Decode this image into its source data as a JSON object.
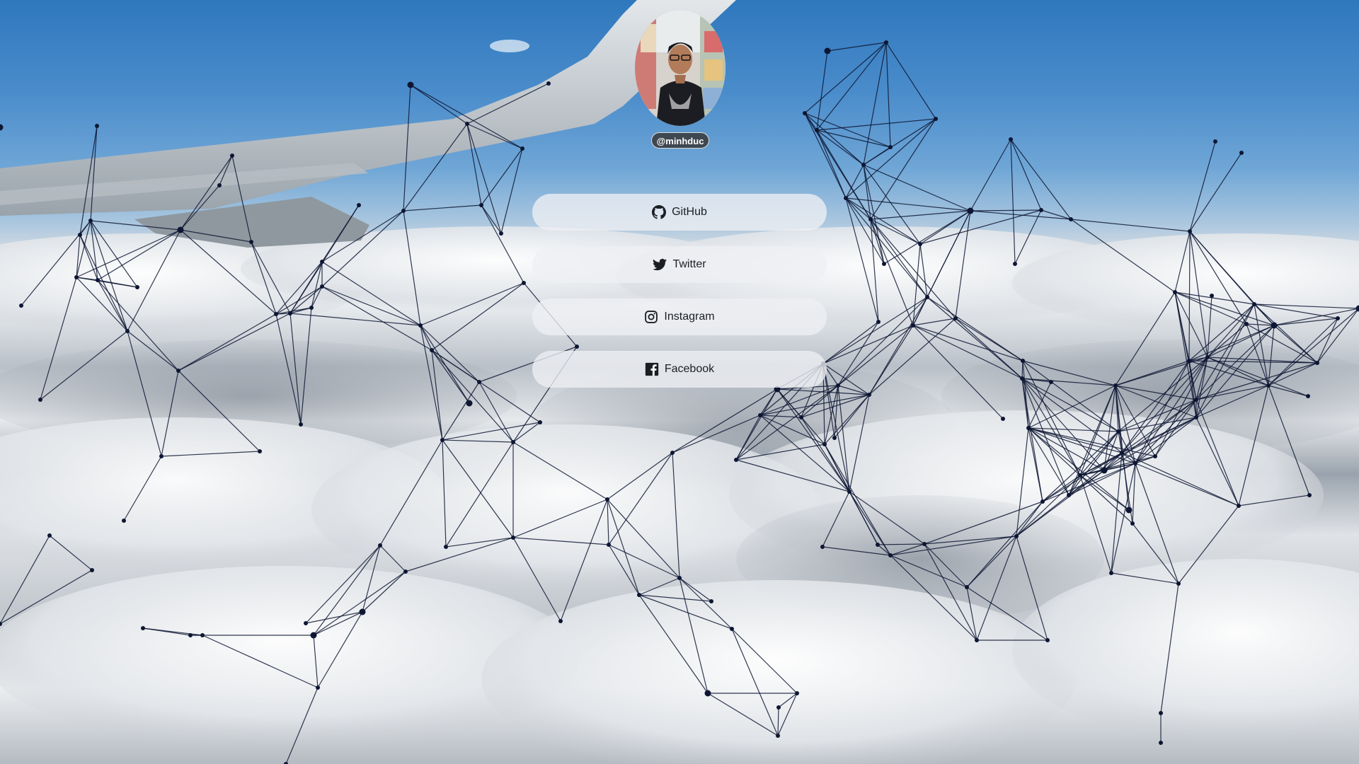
{
  "profile": {
    "handle": "@minhduc"
  },
  "links": [
    {
      "label": "GitHub",
      "icon": "github-icon"
    },
    {
      "label": "Twitter",
      "icon": "twitter-icon"
    },
    {
      "label": "Instagram",
      "icon": "instagram-icon"
    },
    {
      "label": "Facebook",
      "icon": "facebook-icon"
    }
  ],
  "theme": {
    "sky": "#2f78bd",
    "network_line": "#0d1633",
    "button_bg": "#eef0f3",
    "badge_bg": "#3f4750"
  }
}
